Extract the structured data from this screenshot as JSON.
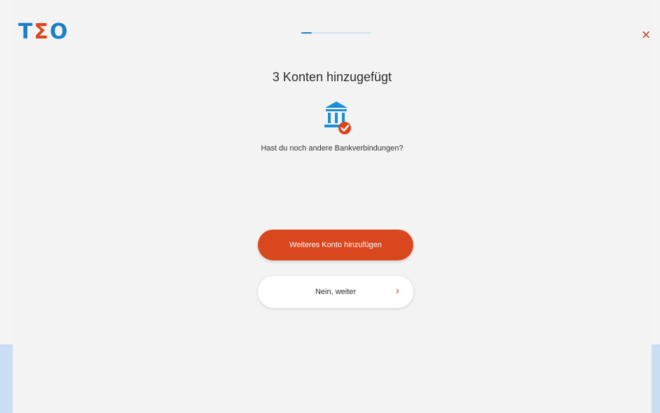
{
  "brand": {
    "logo_letters": [
      "T",
      "Σ",
      "O"
    ],
    "logo_colors": [
      "#1b7fc4",
      "#d9471f",
      "#1b7fc4"
    ]
  },
  "progress": {
    "fraction": 0.15,
    "track_color": "#cfe4f2",
    "fill_color": "#1b84c4"
  },
  "header": {
    "close_icon": "close-icon",
    "close_glyph": "×"
  },
  "main": {
    "title": "3 Konten hinzugefügt",
    "icon": "bank-check-icon",
    "subtitle": "Hast du noch andere  Bankverbindungen?"
  },
  "actions": {
    "add_account_label": "Weiteres Konto hinzufügen",
    "continue_label": "Nein, weiter",
    "continue_icon": "chevron-right-icon",
    "continue_glyph": "›"
  },
  "colors": {
    "accent": "#d9471f",
    "brand_blue": "#1b7fc4",
    "icon_blue": "#1a8ed6"
  }
}
